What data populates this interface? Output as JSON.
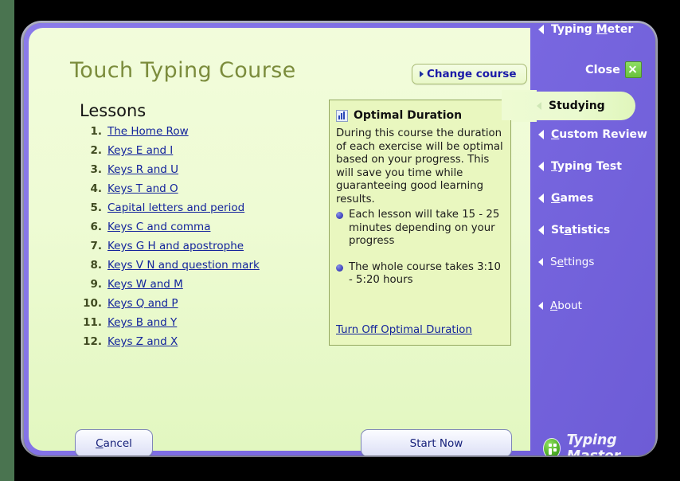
{
  "window": {
    "title": "Touch Typing Course",
    "change_course_label": "Change course",
    "close_label": "Close",
    "close_icon": "close-x-icon"
  },
  "lessons": {
    "heading": "Lessons",
    "items": [
      {
        "num": "1.",
        "title": "The Home Row"
      },
      {
        "num": "2.",
        "title": "Keys E and I"
      },
      {
        "num": "3.",
        "title": "Keys R and U"
      },
      {
        "num": "4.",
        "title": "Keys T and O"
      },
      {
        "num": "5.",
        "title": "Capital letters and period"
      },
      {
        "num": "6.",
        "title": "Keys C and comma"
      },
      {
        "num": "7.",
        "title": "Keys G H and apostrophe"
      },
      {
        "num": "8.",
        "title": "Keys V N and question mark"
      },
      {
        "num": "9.",
        "title": "Keys W and M"
      },
      {
        "num": "10.",
        "title": "Keys Q and P"
      },
      {
        "num": "11.",
        "title": "Keys B and Y"
      },
      {
        "num": "12.",
        "title": "Keys Z and X"
      }
    ]
  },
  "info_panel": {
    "icon": "bar-chart-icon",
    "title": "Optimal Duration",
    "body": "During this course the duration of each exercise will be optimal based on your progress. This will save you time while guaranteeing good learning results.",
    "bullets": [
      "Each lesson will take 15 - 25 minutes depending on your progress",
      "The whole course takes 3:10 - 5:20 hours"
    ],
    "link_label": "Turn Off Optimal Duration"
  },
  "footer": {
    "cancel_label": "Cancel",
    "cancel_accel": "C",
    "cancel_rest": "ancel",
    "start_label": "Start Now"
  },
  "sidebar": {
    "active": "Studying",
    "items": [
      {
        "label": "Studying",
        "accel": "",
        "pre": "Studying",
        "post": "",
        "active": true,
        "secondary": false
      },
      {
        "label": "Typing Meter",
        "accel": "M",
        "pre": "Typing ",
        "post": "eter",
        "active": false,
        "secondary": false
      },
      {
        "label": "Custom Review",
        "accel": "C",
        "pre": "",
        "post": "ustom Review",
        "active": false,
        "secondary": false
      },
      {
        "label": "Typing Test",
        "accel": "T",
        "pre": "",
        "post": "yping Test",
        "active": false,
        "secondary": false
      },
      {
        "label": "Games",
        "accel": "G",
        "pre": "",
        "post": "ames",
        "active": false,
        "secondary": false
      },
      {
        "label": "Statistics",
        "accel": "a",
        "pre": "St",
        "post": "tistics",
        "active": false,
        "secondary": false
      },
      {
        "label": "Settings",
        "accel": "e",
        "pre": "S",
        "post": "ttings",
        "active": false,
        "secondary": true
      },
      {
        "label": "About",
        "accel": "A",
        "pre": "",
        "post": "bout",
        "active": false,
        "secondary": true
      }
    ]
  },
  "brand": {
    "name": "Typing Master",
    "logo_icon": "typing-master-logo-icon"
  },
  "colors": {
    "window_purple": "#6f5fdc",
    "content_green": "#eefbd3",
    "panel_green": "#e9f7bf",
    "link_blue": "#13249c",
    "title_olive": "#7b8c3c",
    "accent_green": "#69c13c"
  }
}
